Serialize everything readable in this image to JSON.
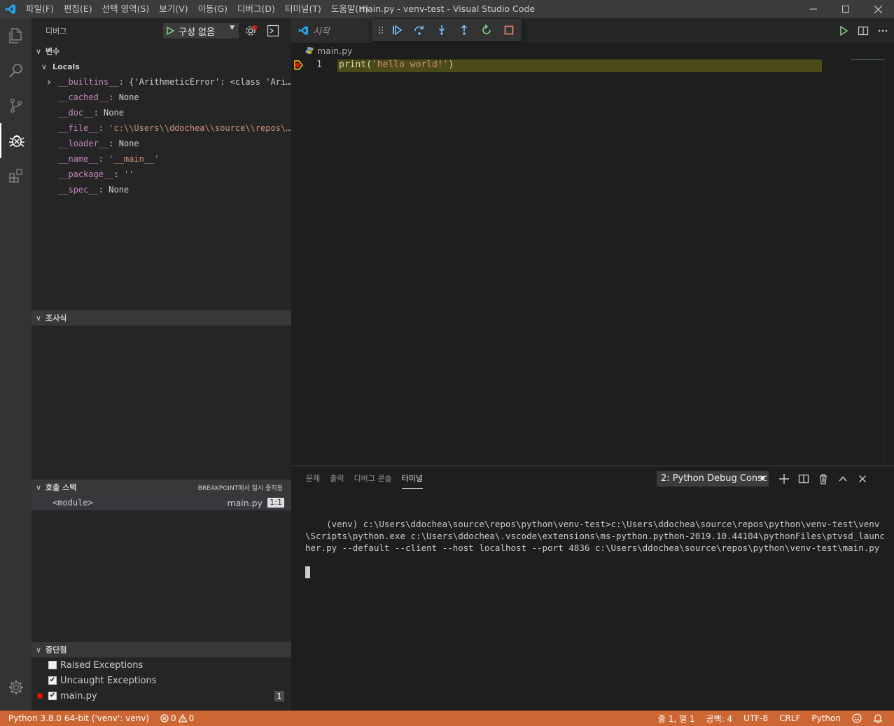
{
  "window": {
    "title": "main.py - venv-test - Visual Studio Code"
  },
  "menu": [
    "파일(F)",
    "편집(E)",
    "선택 영역(S)",
    "보기(V)",
    "이동(G)",
    "디버그(D)",
    "터미널(T)",
    "도움말(H)"
  ],
  "sidebar": {
    "header": "디버그",
    "run_config": "구성 없음",
    "variables": {
      "title": "변수",
      "scope": "Locals",
      "items": [
        {
          "name": "__builtins__",
          "sep": ": ",
          "value": "{'ArithmeticError': <class 'Ari…",
          "kind": "plain",
          "expandable": true
        },
        {
          "name": "__cached__",
          "sep": ": ",
          "value": "None",
          "kind": "plain"
        },
        {
          "name": "__doc__",
          "sep": ": ",
          "value": "None",
          "kind": "plain"
        },
        {
          "name": "__file__",
          "sep": ": ",
          "value": "'c:\\\\Users\\\\ddochea\\\\source\\\\repos\\…",
          "kind": "string"
        },
        {
          "name": "__loader__",
          "sep": ": ",
          "value": "None",
          "kind": "plain"
        },
        {
          "name": "__name__",
          "sep": ": ",
          "value": "'__main__'",
          "kind": "string"
        },
        {
          "name": "__package__",
          "sep": ": ",
          "value": "''",
          "kind": "string"
        },
        {
          "name": "__spec__",
          "sep": ": ",
          "value": "None",
          "kind": "plain"
        }
      ]
    },
    "watch": {
      "title": "조사식"
    },
    "callstack": {
      "title": "호출 스택",
      "status": "BREAKPOINT에서 일시 중지됨",
      "frames": [
        {
          "name": "<module>",
          "file": "main.py",
          "pos": "1:1"
        }
      ]
    },
    "breakpoints": {
      "title": "중단점",
      "items": [
        {
          "label": "Raised Exceptions",
          "checked": false
        },
        {
          "label": "Uncaught Exceptions",
          "checked": true
        },
        {
          "label": "main.py",
          "checked": true,
          "count": "1",
          "dot": true
        }
      ]
    }
  },
  "editor": {
    "tab_label": "시작",
    "breadcrumb": "main.py",
    "lines": [
      {
        "number": "1",
        "fn": "print",
        "open": "(",
        "str": "'hello world!'",
        "close": ")"
      }
    ]
  },
  "panel": {
    "tabs": [
      "문제",
      "출력",
      "디버그 콘솔",
      "터미널"
    ],
    "active_tab": "터미널",
    "terminal_select": "2: Python Debug Consc",
    "terminal_output": "(venv) c:\\Users\\ddochea\\source\\repos\\python\\venv-test>c:\\Users\\ddochea\\source\\repos\\python\\venv-test\\venv\\Scripts\\python.exe c:\\Users\\ddochea\\.vscode\\extensions\\ms-python.python-2019.10.44104\\pythonFiles\\ptvsd_launcher.py --default --client --host localhost --port 4836 c:\\Users\\ddochea\\source\\repos\\python\\venv-test\\main.py"
  },
  "statusbar": {
    "interpreter": "Python 3.8.0 64-bit ('venv': venv)",
    "errors": "0",
    "warnings": "0",
    "position": "줄 1, 열 1",
    "spaces": "공백: 4",
    "encoding": "UTF-8",
    "eol": "CRLF",
    "language": "Python",
    "color": "#cc6633"
  },
  "colors": {
    "accent": "#007acc",
    "debug_status": "#cc6633",
    "breakpoint": "#e51400",
    "current_line": "#4b4b18"
  }
}
